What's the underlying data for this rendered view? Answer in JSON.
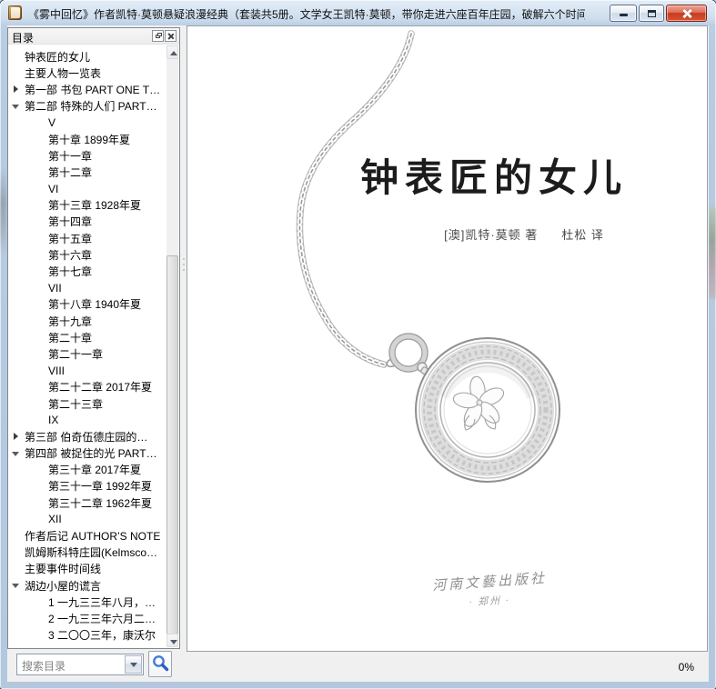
{
  "window": {
    "title": "《雾中回忆》作者凯特·莫顿悬疑浪漫经典（套装共5册。文学女王凯特·莫顿，带你走进六座百年庄园，破解六个时间之...",
    "icon": "book-icon",
    "controls": [
      {
        "name": "minimize",
        "icon": "minimize-icon"
      },
      {
        "name": "maximize",
        "icon": "maximize-icon"
      },
      {
        "name": "close",
        "icon": "close-icon"
      }
    ]
  },
  "toc": {
    "header": "目录",
    "panel_buttons": [
      {
        "name": "float",
        "icon": "float-panel-icon"
      },
      {
        "name": "close",
        "icon": "close-panel-icon"
      }
    ],
    "items": [
      {
        "label": "钟表匠的女儿",
        "level": 1,
        "arrow": "none"
      },
      {
        "label": "主要人物一览表",
        "level": 1,
        "arrow": "none"
      },
      {
        "label": "第一部 书包 PART ONE T…",
        "level": 1,
        "arrow": "collapsed"
      },
      {
        "label": "第二部 特殊的人们 PART…",
        "level": 1,
        "arrow": "expanded"
      },
      {
        "label": "V",
        "level": 2,
        "arrow": "none"
      },
      {
        "label": "第十章 1899年夏",
        "level": 2,
        "arrow": "none"
      },
      {
        "label": "第十一章",
        "level": 2,
        "arrow": "none"
      },
      {
        "label": "第十二章",
        "level": 2,
        "arrow": "none"
      },
      {
        "label": "VI",
        "level": 2,
        "arrow": "none"
      },
      {
        "label": "第十三章 1928年夏",
        "level": 2,
        "arrow": "none"
      },
      {
        "label": "第十四章",
        "level": 2,
        "arrow": "none"
      },
      {
        "label": "第十五章",
        "level": 2,
        "arrow": "none"
      },
      {
        "label": "第十六章",
        "level": 2,
        "arrow": "none"
      },
      {
        "label": "第十七章",
        "level": 2,
        "arrow": "none"
      },
      {
        "label": "VII",
        "level": 2,
        "arrow": "none"
      },
      {
        "label": "第十八章 1940年夏",
        "level": 2,
        "arrow": "none"
      },
      {
        "label": "第十九章",
        "level": 2,
        "arrow": "none"
      },
      {
        "label": "第二十章",
        "level": 2,
        "arrow": "none"
      },
      {
        "label": "第二十一章",
        "level": 2,
        "arrow": "none"
      },
      {
        "label": "VIII",
        "level": 2,
        "arrow": "none"
      },
      {
        "label": "第二十二章 2017年夏",
        "level": 2,
        "arrow": "none"
      },
      {
        "label": "第二十三章",
        "level": 2,
        "arrow": "none"
      },
      {
        "label": "IX",
        "level": 2,
        "arrow": "none"
      },
      {
        "label": "第三部 伯奇伍德庄园的…",
        "level": 1,
        "arrow": "collapsed"
      },
      {
        "label": "第四部 被捉住的光 PART…",
        "level": 1,
        "arrow": "expanded"
      },
      {
        "label": "第三十章 2017年夏",
        "level": 2,
        "arrow": "none"
      },
      {
        "label": "第三十一章 1992年夏",
        "level": 2,
        "arrow": "none"
      },
      {
        "label": "第三十二章 1962年夏",
        "level": 2,
        "arrow": "none"
      },
      {
        "label": "XII",
        "level": 2,
        "arrow": "none"
      },
      {
        "label": "作者后记 AUTHOR’S NOTE",
        "level": 1,
        "arrow": "none"
      },
      {
        "label": "凯姆斯科特庄园(Kelmsco…",
        "level": 1,
        "arrow": "none"
      },
      {
        "label": "主要事件时间线",
        "level": 1,
        "arrow": "none"
      },
      {
        "label": "湖边小屋的谎言",
        "level": 1,
        "arrow": "expanded"
      },
      {
        "label": "1 一九三三年八月，…",
        "level": 2,
        "arrow": "none"
      },
      {
        "label": "2 一九三三年六月二…",
        "level": 2,
        "arrow": "none"
      },
      {
        "label": "3 二〇〇三年，康沃尔",
        "level": 2,
        "arrow": "none"
      }
    ]
  },
  "search": {
    "placeholder": "搜索目录",
    "dropdown_icon": "chevron-down-icon",
    "button_icon": "search-icon"
  },
  "status": {
    "progress": "0%"
  },
  "cover": {
    "title": "钟表匠的女儿",
    "author": "[澳]凯特·莫顿 著",
    "translator": "杜松 译",
    "publisher": "河南文藝出版社",
    "city": "· 郑州 ·",
    "artwork": "pocket-watch-and-chain-illustration"
  },
  "colors": {
    "frame": "#b7cbe1",
    "close_button": "#c73a24",
    "accent_blue": "#3b6fd4",
    "panel_border": "#828790"
  }
}
